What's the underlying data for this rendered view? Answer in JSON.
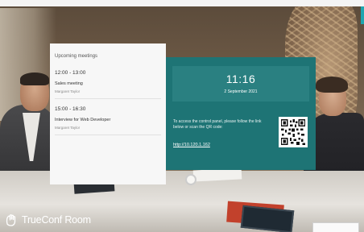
{
  "meetings_panel": {
    "title": "Upcoming meetings",
    "items": [
      {
        "time": "12:00 - 13:00",
        "name": "Sales meeting",
        "host": "Margaret Taylor"
      },
      {
        "time": "15:00 - 16:30",
        "name": "Interview for Web Developer",
        "host": "Margaret Taylor"
      }
    ]
  },
  "info_panel": {
    "time": "11:16",
    "date": "2 September 2021",
    "access_text": "To access the control panel, please follow the link below or scan the QR code:",
    "link": "http://10.120.1.162",
    "qr_icon": "qr-code-icon"
  },
  "branding": {
    "name": "TrueConf Room",
    "icon": "trueconf-logo-icon"
  },
  "colors": {
    "teal_panel": "#1e7475",
    "teal_clock_box": "#2a8081",
    "meetings_bg": "#f7f7f7"
  }
}
